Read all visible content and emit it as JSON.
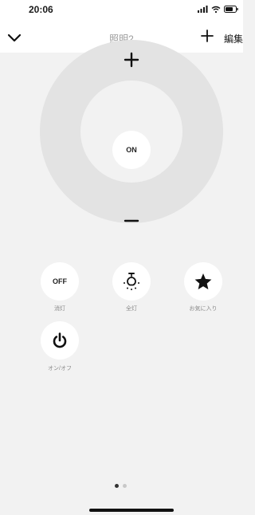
{
  "status_bar": {
    "time": "20:06"
  },
  "header": {
    "title": "照明2",
    "edit_label": "編集"
  },
  "dial": {
    "center_label": "ON"
  },
  "buttons": [
    {
      "label": "OFF",
      "caption": "消灯"
    },
    {
      "label": "",
      "caption": "全灯"
    },
    {
      "label": "",
      "caption": "お気に入り"
    },
    {
      "label": "",
      "caption": "オン/オフ"
    }
  ],
  "icons": {
    "back": "chevron-down-icon",
    "add": "plus-icon",
    "all_light": "light-bulb-icon",
    "favorite": "star-icon",
    "power": "power-icon"
  },
  "pagination": {
    "pages": 2,
    "current": 1
  }
}
